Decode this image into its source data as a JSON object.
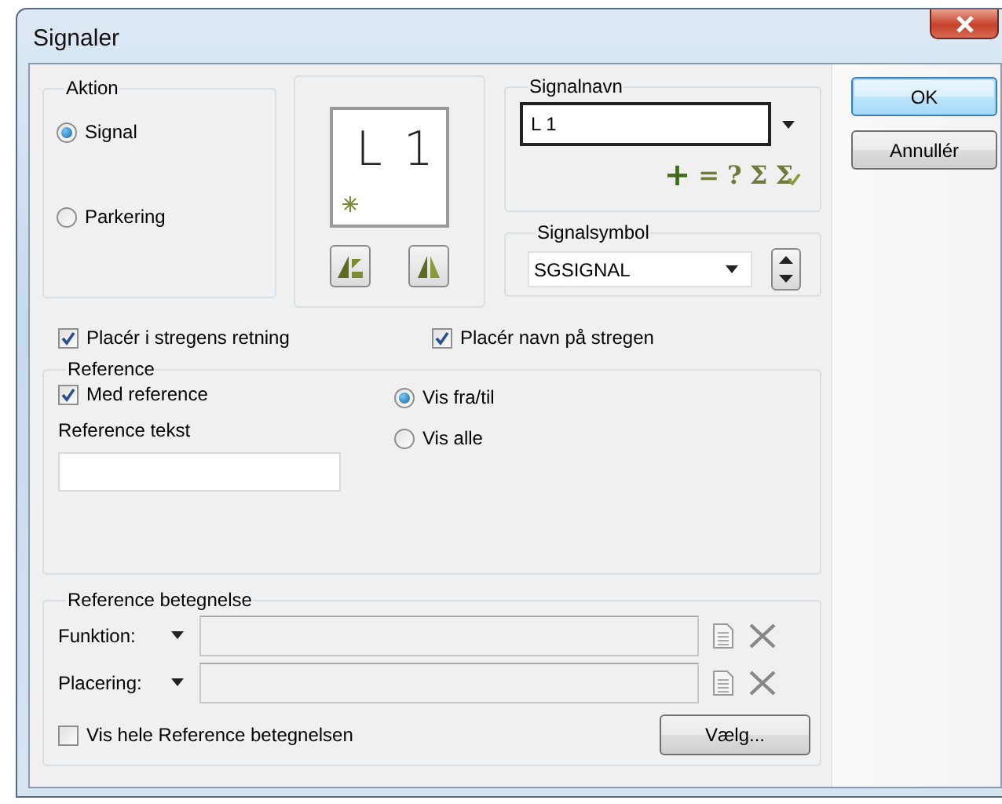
{
  "window": {
    "title": "Signaler"
  },
  "action_group": {
    "title": "Aktion",
    "options": [
      {
        "label": "Signal",
        "selected": true
      },
      {
        "label": "Parkering",
        "selected": false
      }
    ]
  },
  "preview": {
    "text": "L 1"
  },
  "signal_name": {
    "title": "Signalnavn",
    "value": "L 1",
    "tools": [
      {
        "symbol": "+",
        "kind": "add"
      },
      {
        "symbol": "=",
        "kind": "glyph"
      },
      {
        "symbol": "?",
        "kind": "glyph"
      },
      {
        "symbol": "Σ",
        "kind": "glyph"
      },
      {
        "symbol": "Σ",
        "kind": "glyph-check"
      }
    ]
  },
  "signal_symbol": {
    "title": "Signalsymbol",
    "value": "SGSIGNAL"
  },
  "placement_options": [
    {
      "label": "Placér i stregens retning",
      "checked": true
    },
    {
      "label": "Placér navn på stregen",
      "checked": true
    }
  ],
  "reference": {
    "title": "Reference",
    "with_reference": {
      "label": "Med reference",
      "checked": true
    },
    "display_options": [
      {
        "label": "Vis fra/til",
        "selected": true
      },
      {
        "label": "Vis alle",
        "selected": false
      }
    ],
    "text_label": "Reference tekst"
  },
  "designation": {
    "title": "Reference betegnelse",
    "fields": [
      {
        "label": "Funktion:",
        "disabled": true
      },
      {
        "label": "Placering:",
        "disabled": true
      }
    ],
    "show_full": {
      "label": "Vis hele Reference betegnelsen",
      "checked": false
    },
    "choose_button": "Vælg..."
  },
  "buttons": [
    {
      "label": "OK",
      "default": true
    },
    {
      "label": "Annullér",
      "default": false
    }
  ]
}
